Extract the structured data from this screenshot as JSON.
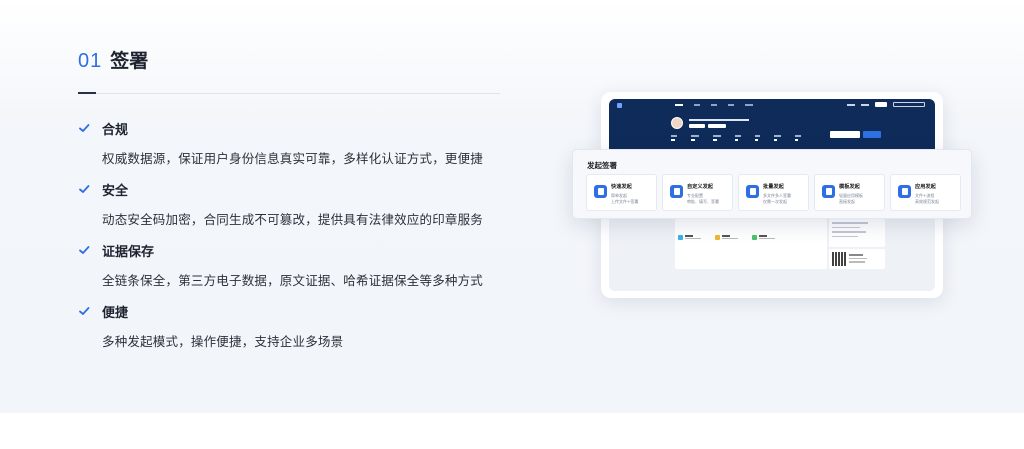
{
  "section": {
    "number": "01",
    "title": "签署"
  },
  "features": [
    {
      "title": "合规",
      "desc": "权威数据源，保证用户身份信息真实可靠，多样化认证方式，更便捷"
    },
    {
      "title": "安全",
      "desc": "动态安全码加密，合同生成不可篡改，提供具有法律效应的印章服务"
    },
    {
      "title": "证据保存",
      "desc": "全链条保全，第三方电子数据，原文证据、哈希证据保全等多种方式"
    },
    {
      "title": "便捷",
      "desc": "多种发起模式，操作便捷，支持企业多场景"
    }
  ],
  "colors": {
    "accent": "#2f6fe4",
    "dark_navy": "#0f2b59",
    "check": "#2f6fe4"
  },
  "popup": {
    "title": "发起签署",
    "cards": [
      {
        "name": "快速发起",
        "d1": "简单发起",
        "d2": "上传文件+签署",
        "icon": "document-icon"
      },
      {
        "name": "自定义发起",
        "d1": "专业配置",
        "d2": "审批、填写、签署",
        "icon": "document-icon"
      },
      {
        "name": "批量发起",
        "d1": "多文件多人签署",
        "d2": "仅需一次发起",
        "icon": "documents-icon"
      },
      {
        "name": "模板发起",
        "d1": "轻量应用模板",
        "d2": "直接发起",
        "icon": "template-icon"
      },
      {
        "name": "应用发起",
        "d1": "文件+流程",
        "d2": "高效规范发起",
        "icon": "app-icon"
      }
    ]
  }
}
